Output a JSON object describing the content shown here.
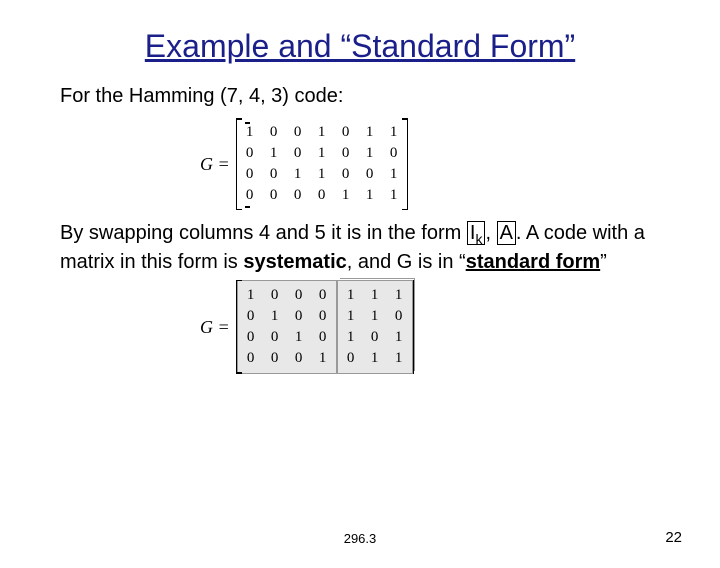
{
  "title": "Example and “Standard Form”",
  "para1": "For the Hamming (7, 4, 3) code:",
  "g_label": "G =",
  "matrix1": [
    [
      "1",
      "0",
      "0",
      "1",
      "0",
      "1",
      "1"
    ],
    [
      "0",
      "1",
      "0",
      "1",
      "0",
      "1",
      "0"
    ],
    [
      "0",
      "0",
      "1",
      "1",
      "0",
      "0",
      "1"
    ],
    [
      "0",
      "0",
      "0",
      "0",
      "1",
      "1",
      "1"
    ]
  ],
  "para2_a": "By swapping columns 4 and 5 it is in the form ",
  "para2_Ik": "I",
  "para2_k": "k",
  "para2_comma": ", ",
  "para2_A": "A",
  "para2_b": ". A code with a matrix in this form is ",
  "para2_sys": "systematic",
  "para2_c": ", and G is in “",
  "para2_std": "standard form",
  "para2_d": "”",
  "matrix2_left": [
    [
      "1",
      "0",
      "0",
      "0"
    ],
    [
      "0",
      "1",
      "0",
      "0"
    ],
    [
      "0",
      "0",
      "1",
      "0"
    ],
    [
      "0",
      "0",
      "0",
      "1"
    ]
  ],
  "matrix2_right": [
    [
      "1",
      "1",
      "1"
    ],
    [
      "1",
      "1",
      "0"
    ],
    [
      "1",
      "0",
      "1"
    ],
    [
      "0",
      "1",
      "1"
    ]
  ],
  "footer_course": "296.3",
  "footer_page": "22"
}
